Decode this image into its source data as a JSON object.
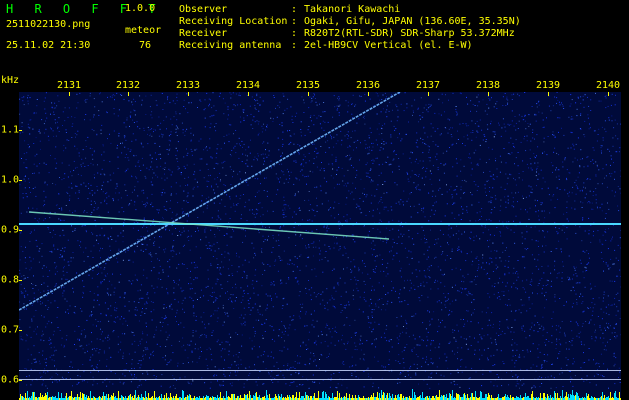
{
  "header": {
    "app_title": "H R O F F T",
    "version": "1.0.0",
    "file_name": "2511022130.png",
    "mode": "meteor",
    "datetime": "25.11.02 21:30",
    "count": "76"
  },
  "info": [
    {
      "label": "Observer",
      "value": "Takanori Kawachi"
    },
    {
      "label": "Receiving Location",
      "value": "Ogaki, Gifu, JAPAN (136.60E, 35.35N)"
    },
    {
      "label": "Receiver",
      "value": "R820T2(RTL-SDR) SDR-Sharp 53.372MHz"
    },
    {
      "label": "Receiving antenna",
      "value": "2el-HB9CV Vertical (el. E-W)"
    }
  ],
  "axis": {
    "y_unit": "kHz",
    "x_ticks": [
      "2131",
      "2132",
      "2133",
      "2134",
      "2135",
      "2136",
      "2137",
      "2138",
      "2139",
      "2140"
    ],
    "y_ticks": [
      "1.1",
      "1.0",
      "0.9",
      "0.8",
      "0.7",
      "0.6"
    ]
  },
  "colors": {
    "background": "#000a3a",
    "label": "#ffff00",
    "title": "#00ff00",
    "carrier": "#4ad8ff",
    "meteor": "#6fb6ff"
  }
}
